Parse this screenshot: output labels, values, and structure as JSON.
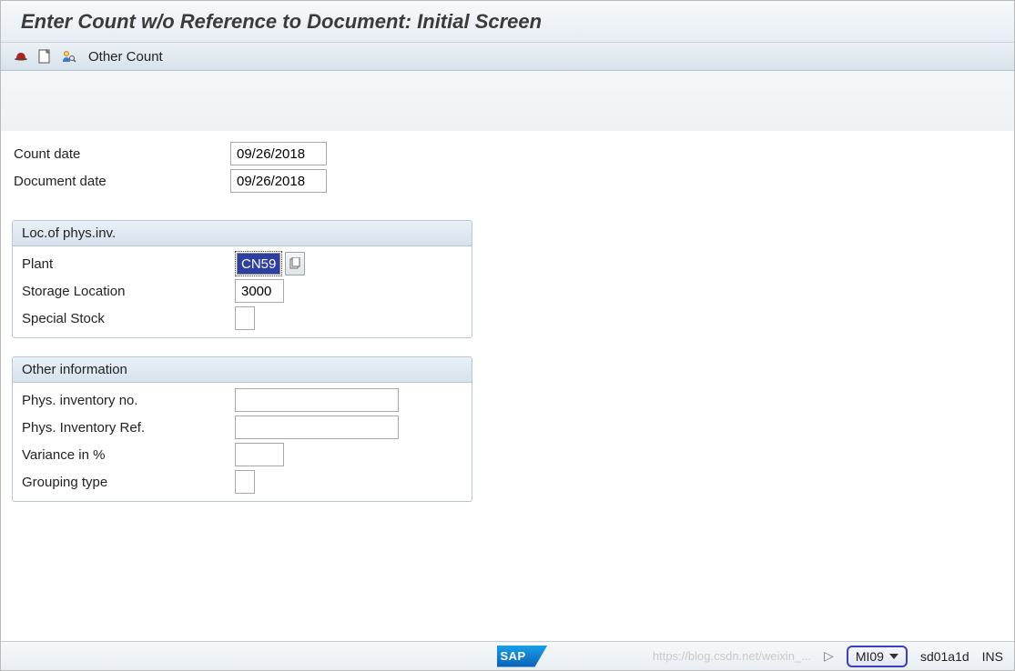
{
  "title": "Enter Count w/o Reference to Document: Initial Screen",
  "toolbar": {
    "icons": {
      "hat": "hat-icon",
      "page": "page-icon",
      "person": "person-icon"
    },
    "other_count_label": "Other Count"
  },
  "dates": {
    "count_date_label": "Count date",
    "count_date_value": "09/26/2018",
    "document_date_label": "Document date",
    "document_date_value": "09/26/2018"
  },
  "loc_group": {
    "title": "Loc.of phys.inv.",
    "plant_label": "Plant",
    "plant_value": "CN59",
    "storage_loc_label": "Storage Location",
    "storage_loc_value": "3000",
    "special_stock_label": "Special Stock",
    "special_stock_value": ""
  },
  "other_group": {
    "title": "Other information",
    "phys_inv_no_label": "Phys. inventory no.",
    "phys_inv_no_value": "",
    "phys_inv_ref_label": "Phys. Inventory Ref.",
    "phys_inv_ref_value": "",
    "variance_label": "Variance in %",
    "variance_value": "",
    "grouping_label": "Grouping type",
    "grouping_value": ""
  },
  "status": {
    "sap_logo_text": "SAP",
    "watermark": "https://blog.csdn.net/weixin_...",
    "tcode": "MI09",
    "system": "sd01a1d",
    "ins": "INS",
    "tri_left": "▷"
  }
}
